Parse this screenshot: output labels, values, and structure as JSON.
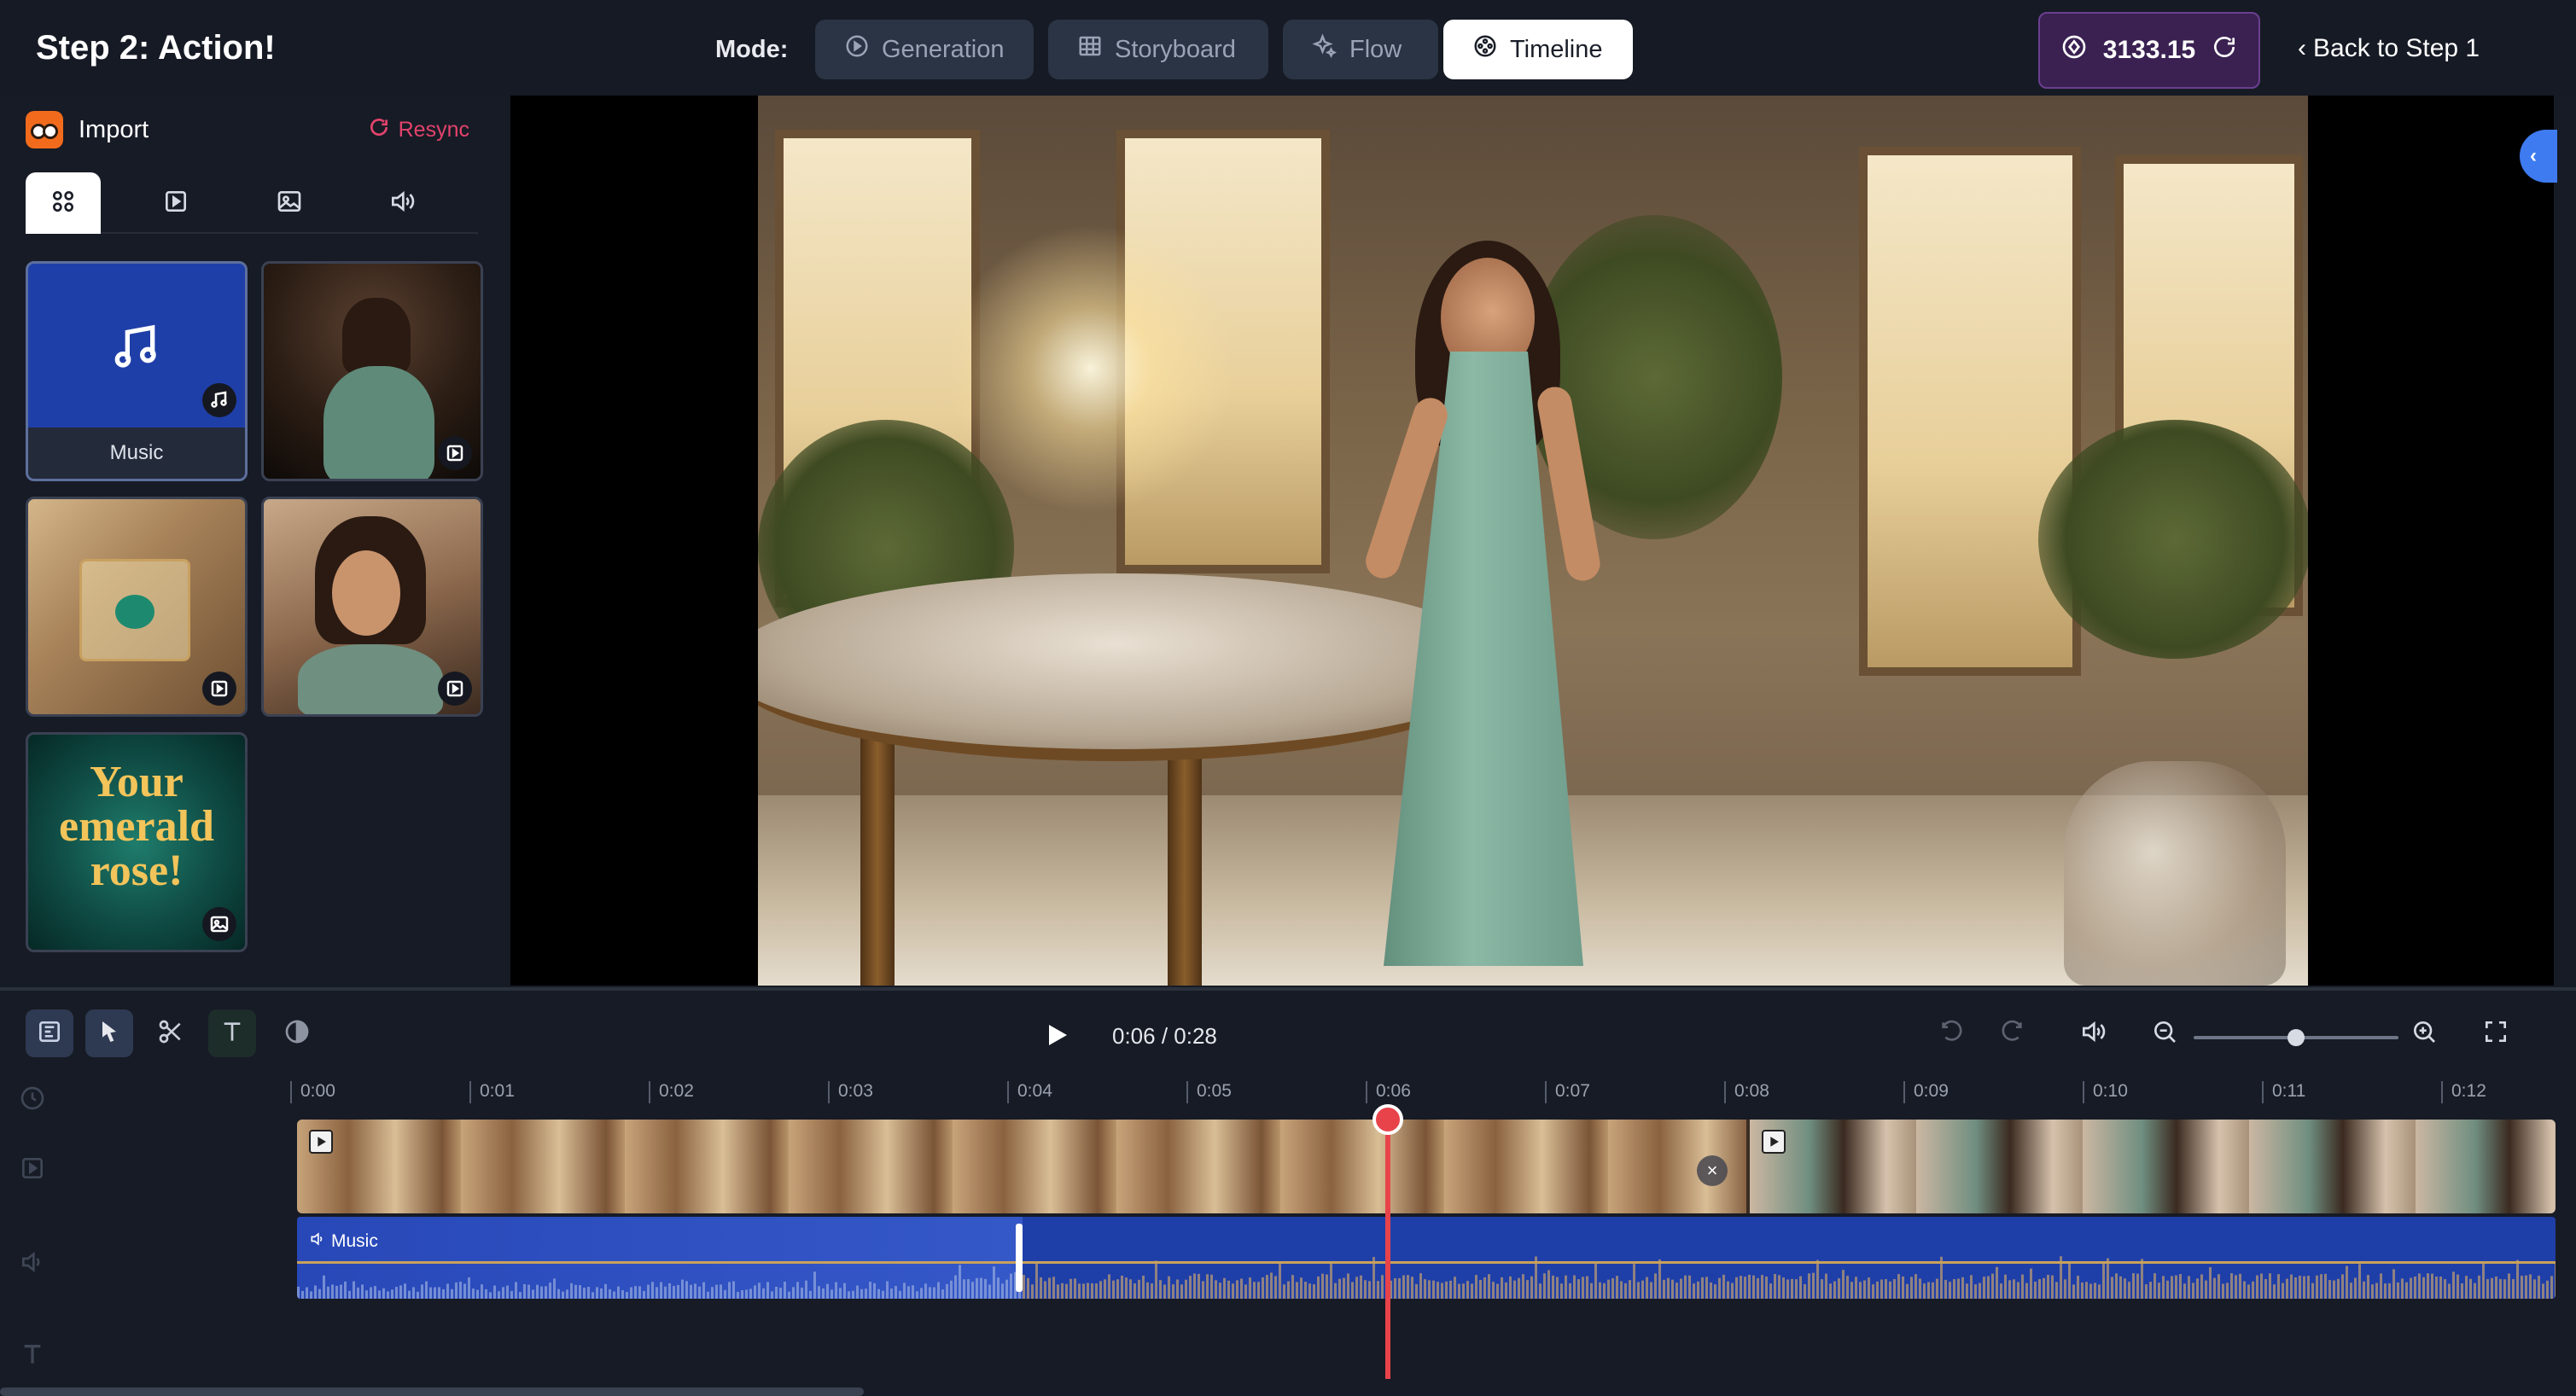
{
  "header": {
    "step_title": "Step 2: Action!",
    "mode_label": "Mode:",
    "modes": [
      {
        "label": "Generation",
        "icon": "play-circle-icon",
        "active": false
      },
      {
        "label": "Storyboard",
        "icon": "grid-icon",
        "active": false
      },
      {
        "label": "Flow",
        "icon": "sparkle-icon",
        "active": false
      },
      {
        "label": "Timeline",
        "icon": "film-reel-icon",
        "active": true
      }
    ],
    "credits": "3133.15",
    "back_link": "Back to Step 1"
  },
  "left_panel": {
    "import_label": "Import",
    "resync_label": "Resync",
    "filter_tabs": [
      {
        "name": "all",
        "icon": "apps-icon",
        "active": true
      },
      {
        "name": "video",
        "icon": "video-icon",
        "active": false
      },
      {
        "name": "image",
        "icon": "image-icon",
        "active": false
      },
      {
        "name": "audio",
        "icon": "speaker-icon",
        "active": false
      }
    ],
    "media": [
      {
        "kind": "audio",
        "caption": "Music",
        "badge": "music-icon"
      },
      {
        "kind": "video",
        "badge": "video-icon"
      },
      {
        "kind": "video",
        "badge": "video-icon"
      },
      {
        "kind": "video",
        "badge": "video-icon"
      },
      {
        "kind": "image",
        "badge": "image-icon",
        "overlay_text": [
          "Your",
          "emerald",
          "rose!"
        ]
      }
    ]
  },
  "timeline": {
    "timecode": "0:06 / 0:28",
    "ruler_ticks": [
      "0:00",
      "0:01",
      "0:02",
      "0:03",
      "0:04",
      "0:05",
      "0:06",
      "0:07",
      "0:08",
      "0:09",
      "0:10",
      "0:11",
      "0:12"
    ],
    "audio_clip_label": "Music",
    "zoom_level": 0.5
  },
  "colors": {
    "accent_blue": "#3e7bf0",
    "playhead": "#e8434b",
    "audio_track": "#1f3fa8",
    "credits_bg": "#3a2152",
    "resync": "#e2436c"
  }
}
